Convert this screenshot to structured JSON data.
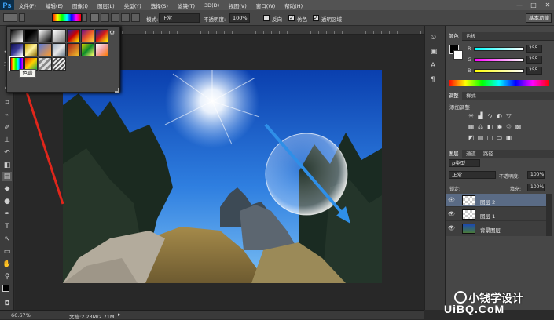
{
  "app": {
    "logo": "Ps"
  },
  "menu": {
    "items": [
      "文件(F)",
      "编辑(E)",
      "图像(I)",
      "图层(L)",
      "类型(Y)",
      "选择(S)",
      "滤镜(T)",
      "3D(D)",
      "视图(V)",
      "窗口(W)",
      "帮助(H)"
    ]
  },
  "window_controls": {
    "min": "—",
    "max": "□",
    "close": "✕"
  },
  "options": {
    "mode_label": "模式:",
    "mode_value": "正常",
    "opacity_label": "不透明度:",
    "opacity_value": "100%",
    "reverse_label": "反向",
    "dither_label": "仿色",
    "transparency_label": "透明区域",
    "workspace_value": "基本功能"
  },
  "picker": {
    "tooltip": "色谱"
  },
  "color_panel": {
    "tabs": [
      "颜色",
      "色板"
    ],
    "r_label": "R",
    "g_label": "G",
    "b_label": "B",
    "r_value": "255",
    "g_value": "255",
    "b_value": "255"
  },
  "adjust_panel": {
    "tabs": [
      "调整",
      "样式"
    ],
    "title": "添加调整"
  },
  "layers_panel": {
    "tabs": [
      "图层",
      "通道",
      "路径"
    ],
    "filter_label": "ρ类型",
    "blend_value": "正常",
    "opacity_label": "不透明度:",
    "opacity_value": "100%",
    "lock_label": "锁定:",
    "fill_label": "填充:",
    "fill_value": "100%",
    "layers": [
      {
        "name": "图层 2"
      },
      {
        "name": "图层 1"
      },
      {
        "name": "背景图层"
      }
    ]
  },
  "status": {
    "zoom": "66.67%",
    "doc": "文档:2.23M/2.71M"
  },
  "watermark": {
    "text": "小钱学设计",
    "site": "UiBQ.CoM"
  },
  "colors": {
    "accent": "#2f6bc4",
    "sky_top": "#0a3fae",
    "sky_bottom": "#4fa3ef",
    "arrow_red": "#e0261b",
    "arrow_blue": "#2f8fe8"
  }
}
